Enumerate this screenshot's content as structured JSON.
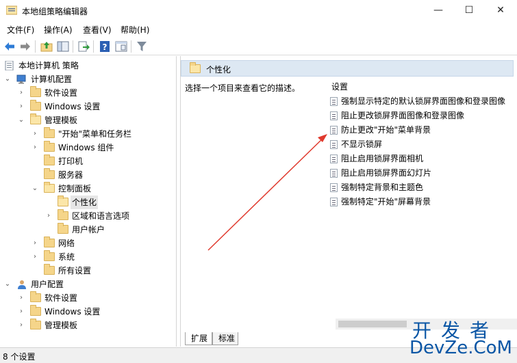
{
  "window": {
    "title": "本地组策略编辑器",
    "min_glyph": "—",
    "max_glyph": "☐",
    "close_glyph": "✕"
  },
  "menu": {
    "file": "文件(F)",
    "action": "操作(A)",
    "view": "查看(V)",
    "help": "帮助(H)"
  },
  "toolbar": {
    "icons": [
      "back-icon",
      "forward-icon",
      "up-folder-icon",
      "show-hide-tree-icon",
      "export-icon",
      "help-icon",
      "properties-icon",
      "filter-icon"
    ]
  },
  "tree": {
    "root": "本地计算机 策略",
    "computer_config": "计算机配置",
    "cc_software": "软件设置",
    "cc_windows": "Windows 设置",
    "cc_admin": "管理模板",
    "cc_start": "\"开始\"菜单和任务栏",
    "cc_wincomp": "Windows 组件",
    "cc_printers": "打印机",
    "cc_server": "服务器",
    "cc_control": "控制面板",
    "cc_personal": "个性化",
    "cc_region": "区域和语言选项",
    "cc_useraccount": "用户帐户",
    "cc_network": "网络",
    "cc_system": "系统",
    "cc_allsettings": "所有设置",
    "user_config": "用户配置",
    "uc_software": "软件设置",
    "uc_windows": "Windows 设置",
    "uc_admin": "管理模板"
  },
  "right": {
    "header": "个性化",
    "description": "选择一个项目来查看它的描述。",
    "settings_head": "设置",
    "settings": [
      "强制显示特定的默认锁屏界面图像和登录图像",
      "阻止更改锁屏界面图像和登录图像",
      "防止更改\"开始\"菜单背景",
      "不显示锁屏",
      "阻止启用锁屏界面相机",
      "阻止启用锁屏界面幻灯片",
      "强制特定背景和主题色",
      "强制特定\"开始\"屏幕背景"
    ]
  },
  "tabs": {
    "extended": "扩展",
    "standard": "标准"
  },
  "status": {
    "text": "8 个设置"
  },
  "watermark": {
    "top": "开发者",
    "bottom": "DevZe.CoM"
  },
  "colors": {
    "header_bg": "#dde8f3",
    "folder": "#f5d58a",
    "annotation_arrow": "#e03a2e",
    "watermark": "#0a56a5"
  }
}
